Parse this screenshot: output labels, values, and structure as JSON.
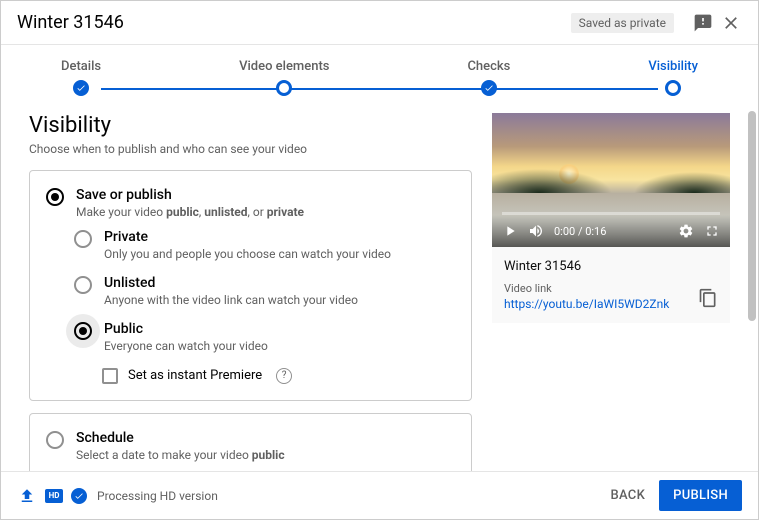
{
  "header": {
    "title": "Winter 31546",
    "status_chip": "Saved as private"
  },
  "stepper": {
    "steps": [
      {
        "label": "Details"
      },
      {
        "label": "Video elements"
      },
      {
        "label": "Checks"
      },
      {
        "label": "Visibility"
      }
    ]
  },
  "visibility": {
    "heading": "Visibility",
    "sub": "Choose when to publish and who can see your video",
    "save_publish": {
      "title": "Save or publish",
      "desc_prefix": "Make your video ",
      "desc_bold1": "public",
      "desc_mid1": ", ",
      "desc_bold2": "unlisted",
      "desc_mid2": ", or ",
      "desc_bold3": "private",
      "options": {
        "private": {
          "title": "Private",
          "desc": "Only you and people you choose can watch your video"
        },
        "unlisted": {
          "title": "Unlisted",
          "desc": "Anyone with the video link can watch your video"
        },
        "public": {
          "title": "Public",
          "desc": "Everyone can watch your video"
        }
      },
      "premiere": {
        "label": "Set as instant Premiere"
      }
    },
    "schedule": {
      "title": "Schedule",
      "desc_prefix": "Select a date to make your video ",
      "desc_bold": "public"
    }
  },
  "preview": {
    "time": "0:00 / 0:16",
    "title": "Winter 31546",
    "link_label": "Video link",
    "link": "https://youtu.be/IaWI5WD2Znk"
  },
  "footer": {
    "hd": "HD",
    "processing": "Processing HD version",
    "back": "BACK",
    "publish": "PUBLISH"
  }
}
